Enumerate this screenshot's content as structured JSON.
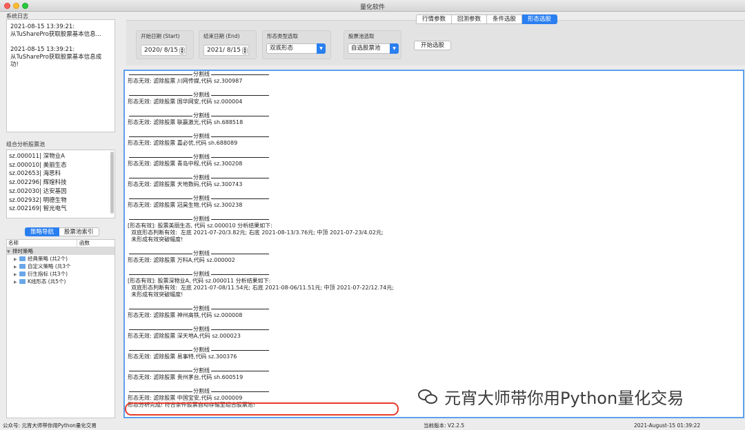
{
  "window": {
    "title": "量化软件"
  },
  "system_log": {
    "label": "系统日志",
    "entries": [
      {
        "time": "2021-08-15 13:39:21:",
        "text": "从TuSharePro获取股票基本信息..."
      },
      {
        "time": "2021-08-15 13:39:21:",
        "text": "从TuSharePro获取股票基本信息成",
        "text2": "功!"
      }
    ]
  },
  "stock_pool": {
    "label": "组合分析股票池",
    "items": [
      "sz.000011| 深物业A",
      "sz.000010| 美丽生态",
      "sz.002653| 海思科",
      "sz.002296| 辉煌科技",
      "sz.002030| 达安基因",
      "sz.002932| 明德生物",
      "sz.002169| 智光电气"
    ]
  },
  "nav_tabs": {
    "strategy": "策略导航",
    "index": "股票池索引"
  },
  "tree": {
    "col_name": "名称",
    "col_func": "函数",
    "root": "择时策略",
    "children": [
      "经典策略 (共2个)",
      "自定义策略 (共3个",
      "衍生指标 (共3个)",
      "K线形态 (共5个)"
    ]
  },
  "top_tabs": [
    "行情参数",
    "回测参数",
    "条件选股",
    "形态选股"
  ],
  "controls": {
    "start_label": "开始日期 (Start)",
    "start_value": "2020/  8/15",
    "end_label": "结束日期 (End)",
    "end_value": "2021/  8/15",
    "pattern_label": "形态类型选取",
    "pattern_value": "双底形态",
    "pool_label": "股票池选取",
    "pool_value": "自选股票池",
    "start_button": "开始选股"
  },
  "separator": "分割线",
  "output": [
    {
      "type": "sep"
    },
    {
      "type": "text",
      "text": "形态无效: 滤除股票 川网传媒,代码 sz.300987"
    },
    {
      "type": "blank"
    },
    {
      "type": "sep"
    },
    {
      "type": "text",
      "text": "形态无效: 滤除股票 国华网安,代码 sz.000004"
    },
    {
      "type": "blank"
    },
    {
      "type": "sep"
    },
    {
      "type": "text",
      "text": "形态无效: 滤除股票 联赢激光,代码 sh.688518"
    },
    {
      "type": "blank"
    },
    {
      "type": "sep"
    },
    {
      "type": "text",
      "text": "形态无效: 滤除股票 嘉必优,代码 sh.688089"
    },
    {
      "type": "blank"
    },
    {
      "type": "sep"
    },
    {
      "type": "text",
      "text": "形态无效: 滤除股票 青岛中程,代码 sz.300208"
    },
    {
      "type": "blank"
    },
    {
      "type": "sep"
    },
    {
      "type": "text",
      "text": "形态无效: 滤除股票 天地数码,代码 sz.300743"
    },
    {
      "type": "blank"
    },
    {
      "type": "sep"
    },
    {
      "type": "text",
      "text": "形态无效: 滤除股票 冠昊生物,代码 sz.300238"
    },
    {
      "type": "blank"
    },
    {
      "type": "sep"
    },
    {
      "type": "text",
      "text": "[形态有效]: 股票美丽生态, 代码 sz.000010 分析结果如下:"
    },
    {
      "type": "text",
      "text": "  双底形态判断有效:  左底 2021-07-20/3.82元; 右底 2021-08-13/3.76元; 中顶 2021-07-23/4.02元;"
    },
    {
      "type": "text",
      "text": "  未形成有效突破幅度!"
    },
    {
      "type": "blank"
    },
    {
      "type": "sep"
    },
    {
      "type": "text",
      "text": "形态无效: 滤除股票 万科A,代码 sz.000002"
    },
    {
      "type": "blank"
    },
    {
      "type": "sep"
    },
    {
      "type": "text",
      "text": "[形态有效]: 股票深物业A, 代码 sz.000011 分析结果如下:"
    },
    {
      "type": "text",
      "text": "  双底形态判断有效:  左底 2021-07-08/11.54元; 右底 2021-08-06/11.51元; 中顶 2021-07-22/12.74元;"
    },
    {
      "type": "text",
      "text": "  未形成有效突破幅度!"
    },
    {
      "type": "blank"
    },
    {
      "type": "sep"
    },
    {
      "type": "text",
      "text": "形态无效: 滤除股票 神州高铁,代码 sz.000008"
    },
    {
      "type": "blank"
    },
    {
      "type": "sep"
    },
    {
      "type": "text",
      "text": "形态无效: 滤除股票 深天地A,代码 sz.000023"
    },
    {
      "type": "blank"
    },
    {
      "type": "sep"
    },
    {
      "type": "text",
      "text": "形态无效: 滤除股票 易事特,代码 sz.300376"
    },
    {
      "type": "blank"
    },
    {
      "type": "sep"
    },
    {
      "type": "text",
      "text": "形态无效: 滤除股票 贵州茅台,代码 sh.600519"
    },
    {
      "type": "blank"
    },
    {
      "type": "sep"
    },
    {
      "type": "text",
      "text": "形态无效: 滤除股票 中国宝安,代码 sz.000009"
    },
    {
      "type": "text",
      "text": "形态分析完成! 符合条件股票自动存储至组合股票池!"
    }
  ],
  "watermark": "元宵大师带你用Python量化交易",
  "statusbar": {
    "left": "公众号: 元宵大师带你用Python量化交易",
    "version": "当前版本: V2.2.5",
    "datetime": "2021-August-15 01:39:22"
  },
  "colors": {
    "accent": "#2a7ff0",
    "highlight": "#e53b2a"
  }
}
